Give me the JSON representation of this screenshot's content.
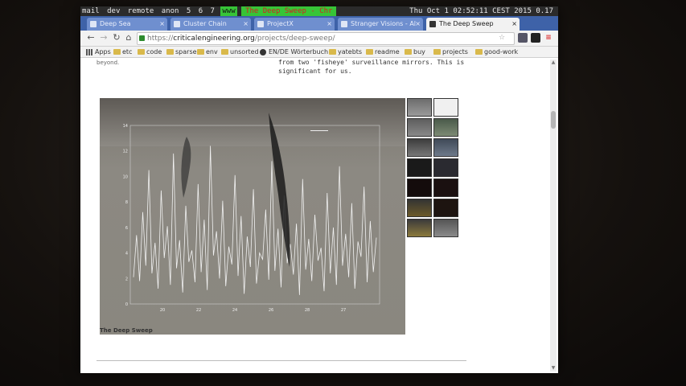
{
  "wm": {
    "workspaces": [
      "mail",
      "dev",
      "remote",
      "anon",
      "5",
      "6",
      "7"
    ],
    "active_workspace": "www",
    "window_title": "The Deep Sweep - Chr",
    "clock": "Thu Oct  1 02:52:11 CEST 2015",
    "load": "0.17"
  },
  "tabs": [
    {
      "label": "Deep Sea"
    },
    {
      "label": "Cluster Chain"
    },
    {
      "label": "ProjectX"
    },
    {
      "label": "Stranger Visions - Al"
    },
    {
      "label": "The Deep Sweep",
      "active": true
    }
  ],
  "toolbar": {
    "url_scheme": "https://",
    "url_host": "criticalengineering.org",
    "url_path": "/projects/deep-sweep/"
  },
  "bookmarks": [
    {
      "label": "Apps",
      "kind": "grid"
    },
    {
      "label": "etc",
      "kind": "folder"
    },
    {
      "label": "code",
      "kind": "folder"
    },
    {
      "label": "sparse",
      "kind": "folder"
    },
    {
      "label": "env",
      "kind": "folder"
    },
    {
      "label": "unsorted",
      "kind": "folder"
    },
    {
      "label": "EN/DE Wörterbuch",
      "kind": "pin"
    },
    {
      "label": "yatebts",
      "kind": "folder"
    },
    {
      "label": "readme",
      "kind": "folder"
    },
    {
      "label": "buy",
      "kind": "folder"
    },
    {
      "label": "projects",
      "kind": "folder"
    },
    {
      "label": "good-work",
      "kind": "folder"
    }
  ],
  "page": {
    "intro_text": "from two 'fisheye' surveillance mirrors. This is\nsignificant for us.",
    "left_fragment": "beyond.",
    "figure_caption": "The Deep Sweep"
  },
  "chart_data": {
    "type": "line",
    "title": "",
    "xlabel": "",
    "ylabel": "",
    "x_tick_labels": [
      "20",
      "22",
      "24",
      "26",
      "28",
      "27"
    ],
    "y_tick_labels": [
      "14",
      "12",
      "10",
      "8",
      "6",
      "4",
      "2",
      "0"
    ],
    "ylim": [
      0,
      14
    ],
    "grid": false,
    "legend_position": "top-right",
    "series": [
      {
        "values": [
          2.1,
          5.4,
          1.8,
          7.2,
          3.0,
          10.5,
          2.4,
          4.8,
          1.2,
          8.9,
          3.6,
          6.1,
          1.5,
          11.8,
          2.8,
          5.0,
          0.9,
          7.7,
          3.3,
          4.2,
          1.7,
          9.4,
          2.5,
          6.6,
          1.1,
          12.4,
          3.8,
          5.7,
          2.0,
          8.1,
          1.4,
          4.5,
          3.1,
          10.1,
          2.2,
          6.9,
          0.8,
          5.3,
          2.9,
          9.0,
          1.6,
          4.0,
          3.5,
          7.4,
          1.9,
          11.2,
          2.6,
          5.9,
          1.3,
          8.5,
          3.2,
          4.7,
          2.3,
          6.3,
          0.7,
          9.8,
          2.7,
          5.1,
          1.8,
          7.0,
          3.4,
          4.4,
          1.0,
          8.7,
          2.4,
          6.0,
          1.5,
          10.8,
          3.0,
          5.5,
          2.1,
          7.9,
          1.2,
          4.9,
          3.7,
          9.2,
          1.7,
          6.5,
          2.5,
          5.2
        ]
      }
    ]
  }
}
